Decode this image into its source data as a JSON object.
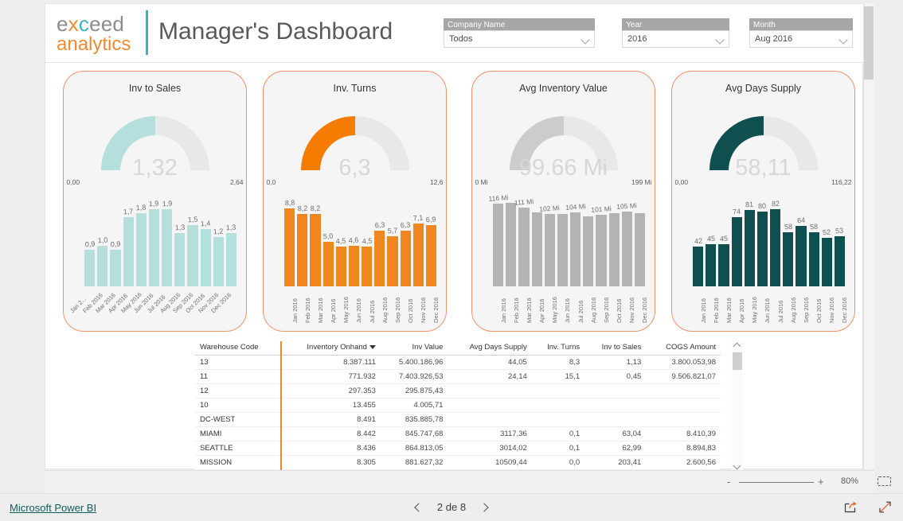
{
  "header": {
    "logo_top": "exceed",
    "logo_bottom": "analytics",
    "title": "Manager's Dashboard"
  },
  "slicers": [
    {
      "name": "company",
      "label": "Company Name",
      "value": "Todos",
      "icon": "chevron-down-icon"
    },
    {
      "name": "year",
      "label": "Year",
      "value": "2016",
      "icon": "chevron-down-icon"
    },
    {
      "name": "month",
      "label": "Month",
      "value": "Aug 2016",
      "icon": "chevron-down-icon"
    }
  ],
  "colors": {
    "accent_orange": "#f0871e",
    "card_border": "#f0916a",
    "teal_light": "#b5dfdc",
    "teal_dark": "#0f4f4f",
    "gray_bar": "#b3b3b3",
    "gauge_track": "#e8e8e8"
  },
  "chart_data": [
    {
      "type": "bar",
      "title": "Inv to Sales",
      "gauge": {
        "value": "1,32",
        "min": "0,00",
        "max": "2,64",
        "fraction": 0.5,
        "color": "#b5dfdc"
      },
      "categories": [
        "Jan 2...",
        "Feb 2016",
        "Mar 2016",
        "Apr 2016",
        "May 2016",
        "Jun 2016",
        "Jul 2016",
        "Aug 2016",
        "Sep 2016",
        "Oct 2016",
        "Nov 2016",
        "Dec 2016"
      ],
      "values": [
        0.9,
        1.0,
        0.9,
        1.7,
        1.8,
        1.9,
        1.9,
        1.3,
        1.5,
        1.4,
        1.2,
        1.3
      ],
      "labels": [
        "0,9",
        "1,0",
        "0,9",
        "1,7",
        "1,8",
        "1,9",
        "1,9",
        "1,3",
        "1,5",
        "1,4",
        "1,2",
        "1,3"
      ],
      "ylim": [
        0,
        2.3
      ],
      "xlabel": "",
      "ylabel": "",
      "grid": false,
      "legend": "none",
      "axis_style": "diagonal"
    },
    {
      "type": "bar",
      "title": "Inv. Turns",
      "gauge": {
        "value": "6,3",
        "min": "0,0",
        "max": "12,6",
        "fraction": 0.5,
        "color": "#f57c00"
      },
      "categories": [
        "Jan 2016",
        "Feb 2016",
        "Mar 2016",
        "Apr 2016",
        "May 2016",
        "Jun 2016",
        "Jul 2016",
        "Aug 2016",
        "Sep 2016",
        "Oct 2016",
        "Nov 2016",
        "Dec 2016"
      ],
      "values": [
        8.8,
        8.2,
        8.2,
        5.0,
        4.5,
        4.6,
        4.5,
        6.3,
        5.7,
        6.3,
        7.1,
        6.9
      ],
      "labels": [
        "8,8",
        "8,2",
        "8,2",
        "5,0",
        "4,5",
        "4,6",
        "4,5",
        "6,3",
        "5,7",
        "6,3",
        "7,1",
        "6,9"
      ],
      "ylim": [
        0,
        10.6
      ],
      "xlabel": "",
      "ylabel": "",
      "grid": false,
      "legend": "none",
      "axis_style": "vertical"
    },
    {
      "type": "bar",
      "title": "Avg Inventory Value",
      "gauge": {
        "value": "99.66 Mi",
        "min": "0 Mi",
        "max": "199 Mi",
        "fraction": 0.5,
        "color": "#cccccc"
      },
      "categories": [
        "Jan 2016",
        "Feb 2016",
        "Mar 2016",
        "Apr 2016",
        "May 2016",
        "Jun 2016",
        "Jul 2016",
        "Aug 2016",
        "Sep 2016",
        "Oct 2016",
        "Nov 2016",
        "Dec 2016"
      ],
      "values": [
        116,
        117,
        111,
        104,
        102,
        102,
        104,
        99,
        101,
        103,
        105,
        103
      ],
      "labels": [
        "116 Mi",
        "",
        "111 Mi",
        "",
        "102 Mi",
        "",
        "104 Mi",
        "",
        "101 Mi",
        "",
        "105 Mi",
        ""
      ],
      "ylim": [
        0,
        132
      ],
      "xlabel": "",
      "ylabel": "",
      "grid": false,
      "legend": "none",
      "axis_style": "vertical"
    },
    {
      "type": "bar",
      "title": "Avg Days Supply",
      "gauge": {
        "value": "58,11",
        "min": "0,00",
        "max": "116,22",
        "fraction": 0.5,
        "color": "#0f4f4f"
      },
      "categories": [
        "Jan 2016",
        "Feb 2016",
        "Mar 2016",
        "Apr 2016",
        "May 2016",
        "Jun 2016",
        "Jul 2016",
        "Aug 2016",
        "Sep 2016",
        "Oct 2016",
        "Nov 2016",
        "Dec 2016"
      ],
      "values": [
        42,
        45,
        45,
        74,
        81,
        80,
        82,
        58,
        64,
        58,
        52,
        53
      ],
      "labels": [
        "42",
        "45",
        "45",
        "74",
        "81",
        "80",
        "82",
        "58",
        "64",
        "58",
        "52",
        "53"
      ],
      "ylim": [
        0,
        100
      ],
      "xlabel": "",
      "ylabel": "",
      "grid": false,
      "legend": "none",
      "axis_style": "vertical"
    }
  ],
  "table": {
    "sort_column": "Inventory Onhand",
    "columns": [
      "Warehouse Code",
      "Inventory Onhand",
      "Inv Value",
      "Avg Days Supply",
      "Inv. Turns",
      "Inv to Sales",
      "COGS Amount"
    ],
    "rows": [
      [
        "13",
        "8.387.111",
        "5.400.186,96",
        "44,05",
        "8,3",
        "1,13",
        "3.800.053,98"
      ],
      [
        "11",
        "771.932",
        "7.403.926,53",
        "24,14",
        "15,1",
        "0,45",
        "9.506.821,07"
      ],
      [
        "12",
        "297.353",
        "295.875,43",
        "",
        "",
        "",
        ""
      ],
      [
        "10",
        "13.455",
        "4.005,71",
        "",
        "",
        "",
        ""
      ],
      [
        "DC-WEST",
        "8.491",
        "835.885,78",
        "",
        "",
        "",
        ""
      ],
      [
        "MIAMI",
        "8.442",
        "845.747,68",
        "3117,36",
        "0,1",
        "63,04",
        "8.410,39"
      ],
      [
        "SEATTLE",
        "8.436",
        "864.813,05",
        "3014,02",
        "0,1",
        "62,99",
        "8.894,83"
      ],
      [
        "MISSION",
        "8.305",
        "881.627,32",
        "10509,44",
        "0,0",
        "203,41",
        "2.600,56"
      ]
    ]
  },
  "zoombar": {
    "minus": "-",
    "plus": "+",
    "percent": "80%",
    "fit_icon": "fit-to-page-icon"
  },
  "footer": {
    "brand_link": "Microsoft Power BI",
    "page_indicator": "2 de 8",
    "prev_icon": "chevron-left-icon",
    "next_icon": "chevron-right-icon",
    "share_icon": "share-icon",
    "fullscreen_icon": "fullscreen-icon"
  }
}
